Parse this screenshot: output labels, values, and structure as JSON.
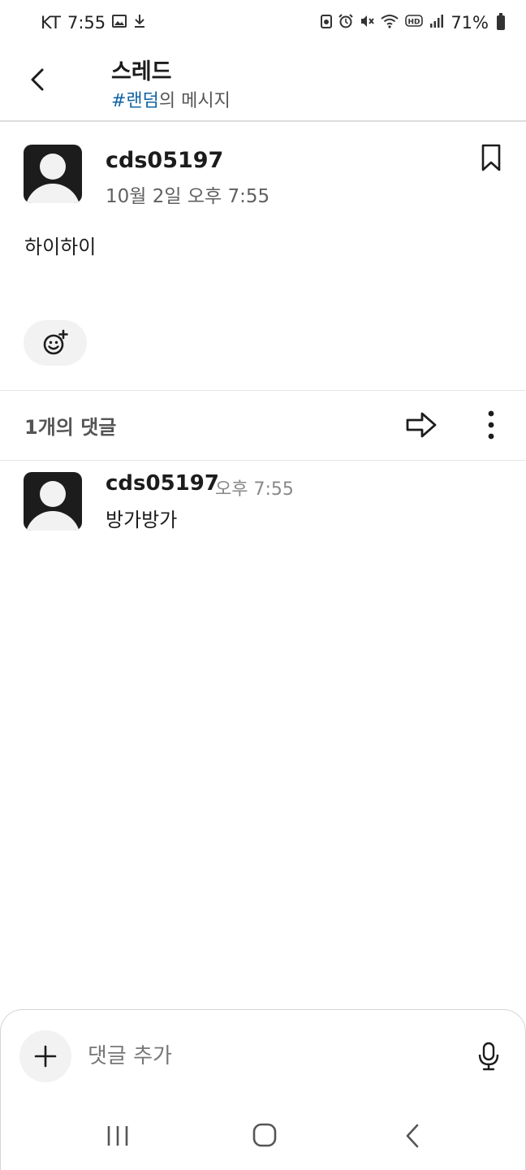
{
  "status_bar": {
    "carrier": "KT",
    "time": "7:55",
    "battery": "71%"
  },
  "header": {
    "title": "스레드",
    "channel": "#랜덤",
    "subtitle_suffix": "의 메시지"
  },
  "parent_message": {
    "author": "cds05197",
    "timestamp": "10월 2일 오후 7:55",
    "text": "하이하이"
  },
  "replies_section": {
    "count_label": "1개의 댓글"
  },
  "replies": [
    {
      "author": "cds05197",
      "time": "오후 7:55",
      "text": "방가방가"
    }
  ],
  "composer": {
    "placeholder": "댓글 추가"
  },
  "icons": {
    "back": "back-arrow-icon",
    "bookmark": "bookmark-icon",
    "emoji": "add-reaction-icon",
    "share": "share-arrow-icon",
    "more": "more-vertical-icon",
    "add": "plus-icon",
    "mic": "microphone-icon"
  },
  "colors": {
    "channel_link": "#1264a3",
    "text_primary": "#1d1c1d",
    "avatar_bg": "#1d1c1d"
  }
}
